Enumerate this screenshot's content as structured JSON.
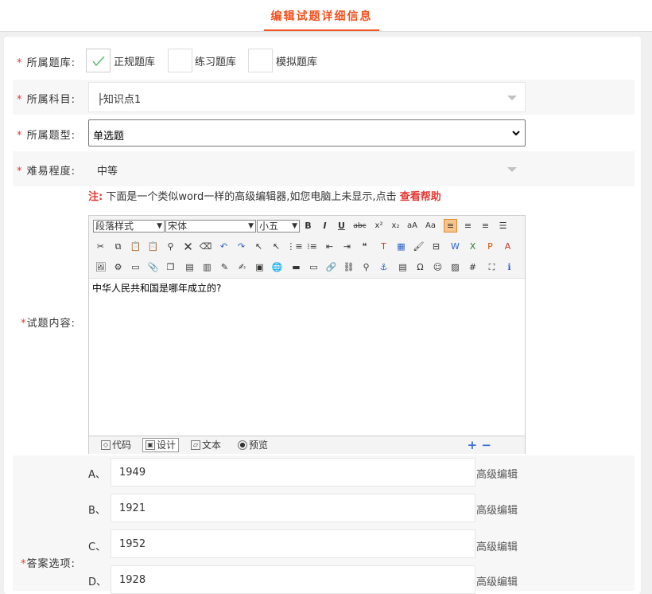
{
  "tab": {
    "title": "编辑试题详细信息"
  },
  "form": {
    "bank": {
      "label": "所属题库:",
      "options": [
        {
          "label": "正规题库",
          "checked": true
        },
        {
          "label": "练习题库",
          "checked": false
        },
        {
          "label": "模拟题库",
          "checked": false
        }
      ]
    },
    "subject": {
      "label": "所属科目:",
      "value": "├知识点1"
    },
    "qtype": {
      "label": "所属题型:",
      "value": "单选题"
    },
    "difficulty": {
      "label": "难易程度:",
      "value": "中等"
    },
    "note": {
      "prefix": "注:",
      "text": "下面是一个类似word一样的高级编辑器,如您电脑上未显示,点击",
      "link": "查看帮助"
    },
    "content": {
      "label": "试题内容:",
      "paragraph_style": "段落样式",
      "font": "宋体",
      "size": "小五",
      "body": "中华人民共和国是哪年成立的?",
      "footer_tabs": [
        "代码",
        "设计",
        "文本",
        "预览"
      ]
    },
    "answers": {
      "label": "答案选项:",
      "advanced_label": "高级编辑",
      "options": [
        {
          "letter": "A、",
          "value": "1949"
        },
        {
          "letter": "B、",
          "value": "1921"
        },
        {
          "letter": "C、",
          "value": "1952"
        },
        {
          "letter": "D、",
          "value": "1928"
        }
      ]
    }
  }
}
